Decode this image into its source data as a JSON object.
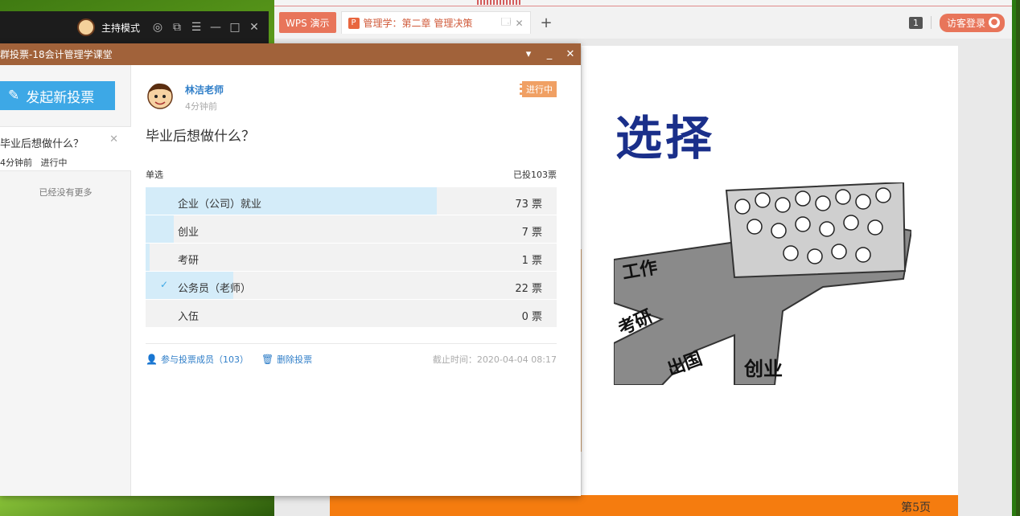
{
  "host_bar": {
    "label": "主持模式"
  },
  "wps": {
    "app_tab": "WPS 演示",
    "doc_tab": "管理学：第二章 管理决策",
    "doc_icon": "P",
    "new_tab": "+",
    "window_count": "1",
    "login": "访客登录"
  },
  "slide": {
    "title": "选择",
    "page": "第5页"
  },
  "dialog": {
    "title": "群投票-18会计管理学课堂",
    "new_poll": "发起新投票",
    "list": [
      {
        "question": "毕业后想做什么？",
        "time": "4分钟前",
        "status": "进行中"
      }
    ],
    "no_more": "已经没有更多",
    "poll": {
      "author": "林洁老师",
      "time": "4分钟前",
      "status": "进行中",
      "question": "毕业后想做什么？",
      "type": "单选",
      "total": "已投103票",
      "options": [
        {
          "label": "企业（公司）就业",
          "votes": "73 票",
          "count": 73,
          "selected": false
        },
        {
          "label": "创业",
          "votes": "7 票",
          "count": 7,
          "selected": false
        },
        {
          "label": "考研",
          "votes": "1 票",
          "count": 1,
          "selected": false
        },
        {
          "label": "公务员（老师）",
          "votes": "22 票",
          "count": 22,
          "selected": true
        },
        {
          "label": "入伍",
          "votes": "0 票",
          "count": 0,
          "selected": false
        }
      ],
      "total_count": 103,
      "members_link": "参与投票成员（103）",
      "delete_link": "删除投票",
      "deadline": "截止时间：2020-04-04 08:17"
    }
  },
  "colors": {
    "accent": "#3da8e6",
    "title_bar": "#a1623a",
    "status": "#f0a064",
    "wps_tab": "#e8755a",
    "slide_bar": "#f57c0f"
  }
}
